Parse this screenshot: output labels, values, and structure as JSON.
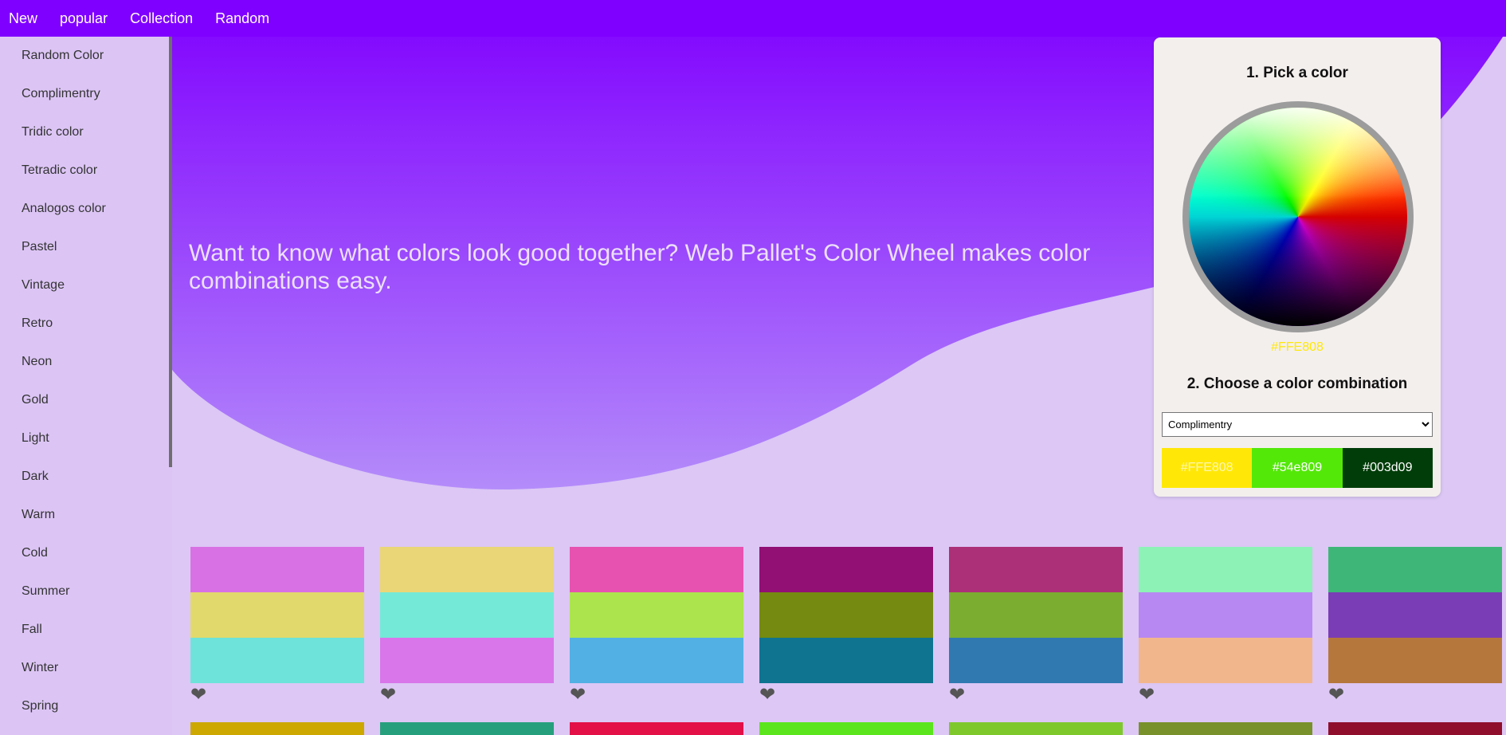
{
  "nav": {
    "items": [
      "New",
      "popular",
      "Collection",
      "Random"
    ]
  },
  "sidebar": {
    "items": [
      "Random Color",
      "Complimentry",
      "Tridic color",
      "Tetradic color",
      "Analogos color",
      "Pastel",
      "Vintage",
      "Retro",
      "Neon",
      "Gold",
      "Light",
      "Dark",
      "Warm",
      "Cold",
      "Summer",
      "Fall",
      "Winter",
      "Spring"
    ]
  },
  "hero": {
    "text": "Want to know what colors look good together? Web Pallet's Color Wheel makes color combinations easy."
  },
  "picker": {
    "step1_title": "1. Pick a color",
    "selected_hex": "#FFE808",
    "step2_title": "2. Choose a color combination",
    "combination_selected": "Complimentry",
    "swatches": [
      {
        "hex": "#FFE808",
        "label": "#FFE808"
      },
      {
        "hex": "#54e809",
        "label": "#54e809"
      },
      {
        "hex": "#003d09",
        "label": "#003d09"
      }
    ]
  },
  "palettes": [
    {
      "colors": [
        "#d872e4",
        "#e2d96c",
        "#6ee3d9"
      ]
    },
    {
      "colors": [
        "#ead676",
        "#74e9d7",
        "#d876ea"
      ]
    },
    {
      "colors": [
        "#e752b0",
        "#ace44e",
        "#52b0e4"
      ]
    },
    {
      "colors": [
        "#920f74",
        "#748a10",
        "#0f7490"
      ]
    },
    {
      "colors": [
        "#ac3077",
        "#7bad30",
        "#3079b0"
      ]
    },
    {
      "colors": [
        "#8cf2b6",
        "#b788f1",
        "#f2b68c"
      ]
    },
    {
      "colors": [
        "#3db678",
        "#7b3db6",
        "#b6773d"
      ]
    }
  ],
  "palettes_next_row": [
    "#cca800",
    "#26a07c",
    "#e31047",
    "#5be51d",
    "#7fc82c",
    "#79912b",
    "#8f0e2c"
  ],
  "colors": {
    "nav_bg": "#8000ff",
    "page_bg": "#dcc7f5",
    "heart": "#555555"
  }
}
